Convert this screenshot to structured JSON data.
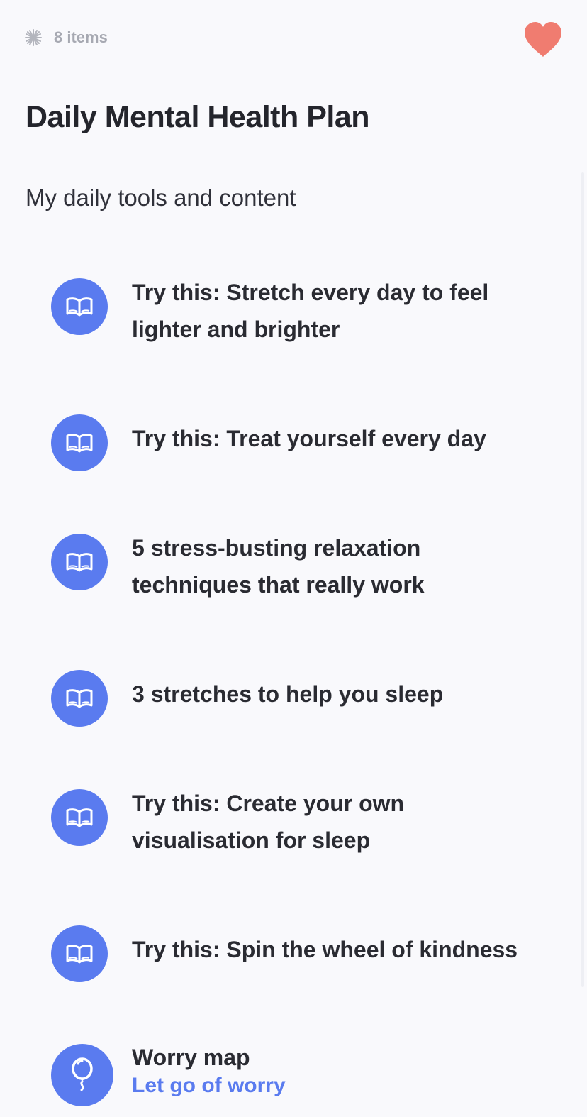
{
  "header": {
    "count_label": "8 items",
    "count_icon": "sparkle-icon",
    "favorite_icon": "heart-icon",
    "favorite_color": "#f07c70"
  },
  "plan": {
    "title": "Daily Mental Health Plan",
    "subtitle": "My daily tools and content"
  },
  "colors": {
    "accent": "#5a7bef",
    "background": "#f9f9fc",
    "text": "#26272e"
  },
  "items": [
    {
      "label": "Try this: Stretch every day to feel lighter and brighter",
      "icon": "book-icon"
    },
    {
      "label": "Try this: Treat yourself every day",
      "icon": "book-icon"
    },
    {
      "label": "5 stress-busting relaxation techniques that really work",
      "icon": "book-icon"
    },
    {
      "label": "3 stretches to help you sleep",
      "icon": "book-icon"
    },
    {
      "label": "Try this: Create your own visualisation for sleep",
      "icon": "book-icon"
    },
    {
      "label": "Try this: Spin the wheel of kindness",
      "icon": "book-icon"
    },
    {
      "label": "Worry map",
      "subtitle": "Let go of worry",
      "icon": "balloon-icon"
    }
  ]
}
